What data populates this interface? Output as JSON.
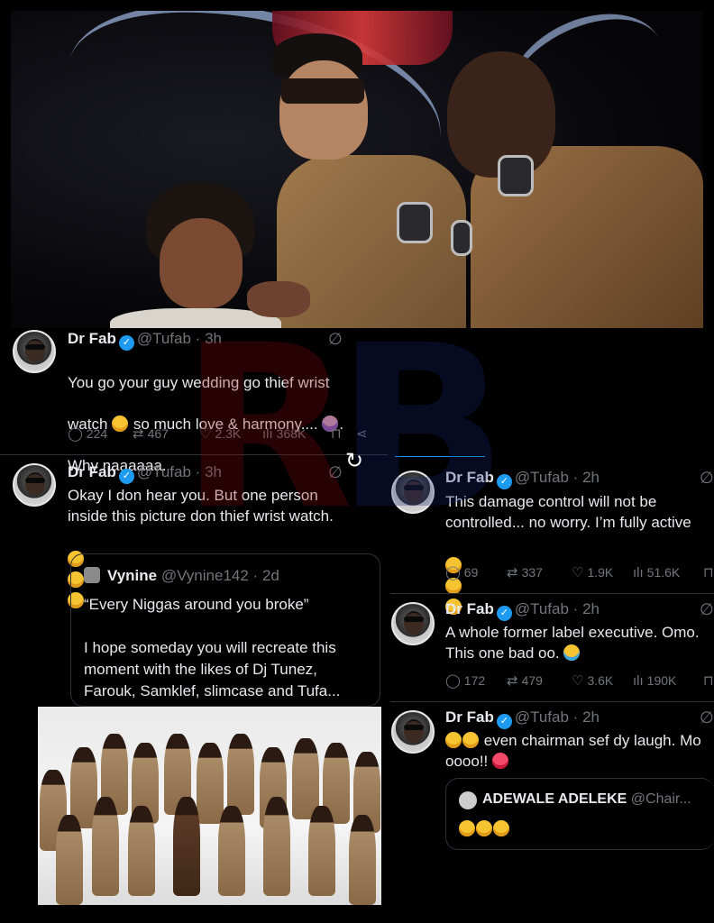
{
  "tweets": [
    {
      "name": "Dr Fab",
      "handle": "@Tufab",
      "time": "3h",
      "text_lines": [
        "You go your guy wedding go thief wrist",
        "watch",
        "so much love & harmony....",
        ".",
        "Why naaaaaa."
      ],
      "replies": "224",
      "reposts": "467",
      "likes": "2.3K",
      "views": "368K"
    },
    {
      "name": "Dr Fab",
      "handle": "@Tufab",
      "time": "3h",
      "text": "Okay I don hear you. But one person\ninside this picture don thief wrist watch.",
      "quote": {
        "name": "Vynine",
        "handle": "@Vynine142",
        "time": "2d",
        "text": "“Every Niggas around you broke”\n\nI hope someday you will recreate this\nmoment with the likes of Dj Tunez,\nFarouk, Samklef, slimcase and Tufa..."
      }
    },
    {
      "name": "Dr Fab",
      "handle": "@Tufab",
      "time": "2h",
      "text": "This damage control will not be\ncontrolled... no worry. I’m fully active",
      "replies": "69",
      "reposts": "337",
      "likes": "1.9K",
      "views": "51.6K"
    },
    {
      "name": "Dr Fab",
      "handle": "@Tufab",
      "time": "2h",
      "text": "A whole former label executive. Omo.\nThis one bad oo.",
      "replies": "172",
      "reposts": "479",
      "likes": "3.6K",
      "views": "190K"
    },
    {
      "name": "Dr Fab",
      "handle": "@Tufab",
      "time": "2h",
      "text_a": "even chairman sef dy laugh. Mo",
      "text_b": "oooo!!",
      "quote": {
        "name": "ADEWALE ADELEKE",
        "handle": "@Chair..."
      }
    }
  ],
  "separator": "·",
  "icons": {
    "verified": "verified-badge-icon",
    "grok": "grok-icon",
    "reply": "reply-icon",
    "repost": "repost-icon",
    "like": "heart-icon",
    "views": "views-icon",
    "bookmark": "bookmark-icon",
    "share": "share-icon",
    "refresh": "refresh-icon"
  },
  "glyphs": {
    "verified": "✓",
    "grok": "∅",
    "reply": "◯",
    "repost": "⇄",
    "like": "♡",
    "views": "ılı",
    "bookmark": "⊓",
    "share": "⋖",
    "refresh": "↻"
  },
  "watermark": {
    "left": "R",
    "right": "B"
  },
  "colors": {
    "accent": "#1d9bf0",
    "muted": "#71767b",
    "text": "#e7e9ea",
    "background": "#000000"
  }
}
